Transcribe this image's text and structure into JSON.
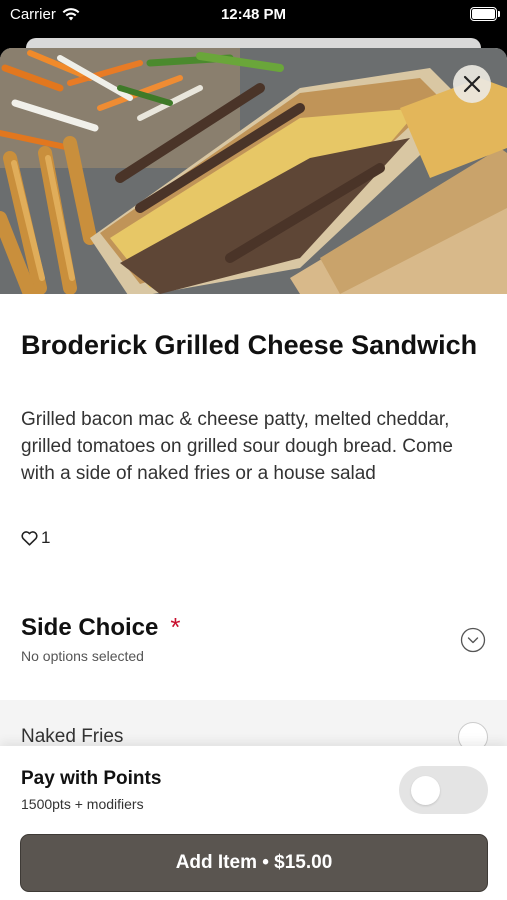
{
  "status_bar": {
    "carrier": "Carrier",
    "time": "12:48 PM"
  },
  "item": {
    "title": "Broderick Grilled Cheese Sandwich",
    "description": "Grilled bacon mac & cheese patty, melted cheddar, grilled tomatoes on grilled sour dough bread. Come with a side of naked fries or a house salad",
    "likes": "1"
  },
  "side_choice": {
    "title": "Side Choice",
    "required_mark": "*",
    "subtitle": "No options selected",
    "options": [
      {
        "label": "Naked Fries",
        "selected": false
      }
    ]
  },
  "pay_with_points": {
    "title": "Pay with Points",
    "subtitle": "1500pts + modifiers",
    "enabled": false
  },
  "add_button": {
    "label": "Add Item • $15.00"
  },
  "icons": {
    "wifi": "wifi-icon",
    "battery": "battery-icon",
    "close": "close-icon",
    "heart": "heart-icon",
    "chevron": "chevron-down-icon",
    "radio": "radio-icon"
  },
  "colors": {
    "required": "#c8102e",
    "button": "#5a5550",
    "toggle_off": "#e4e4e4"
  }
}
